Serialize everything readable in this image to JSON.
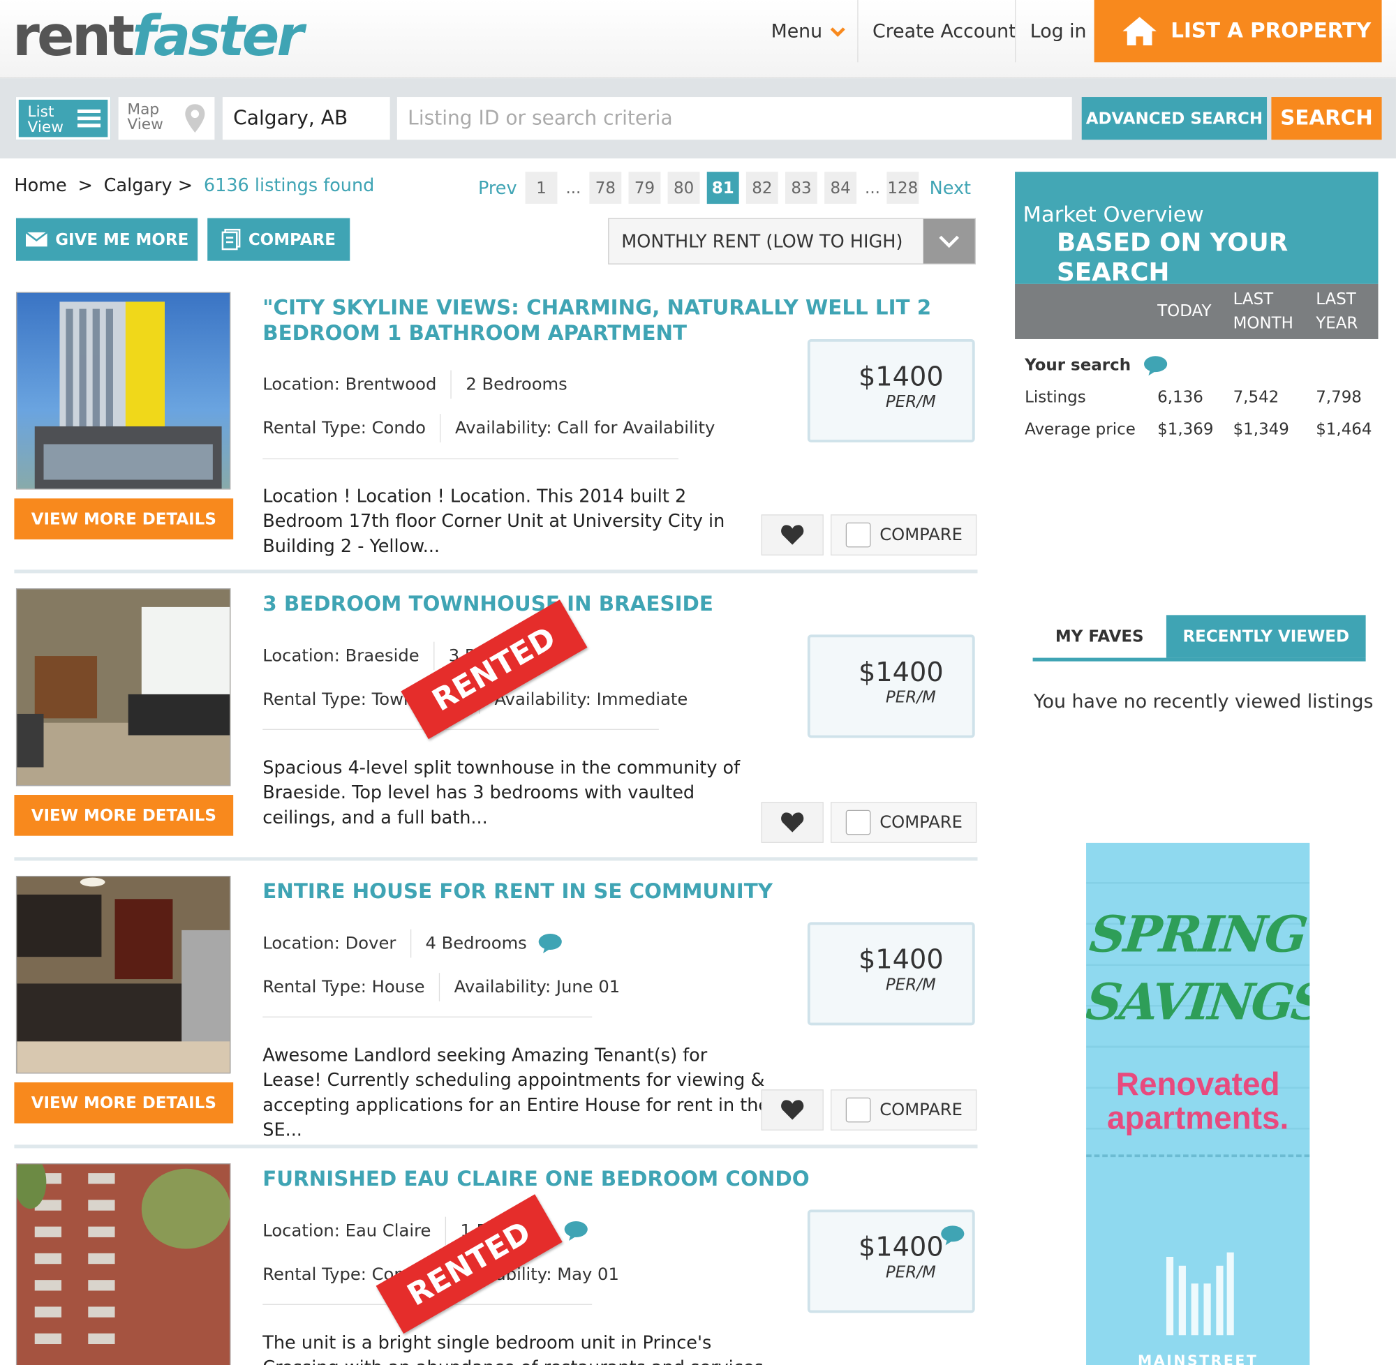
{
  "header": {
    "logo_a": "rent",
    "logo_b": "faster",
    "menu": "Menu",
    "create_account": "Create Account",
    "login": "Log in",
    "list_property": "LIST A PROPERTY"
  },
  "search": {
    "list_view_1": "List",
    "list_view_2": "View",
    "map_view_1": "Map",
    "map_view_2": "View",
    "city": "Calgary, AB",
    "placeholder": "Listing ID or search criteria",
    "advanced": "ADVANCED SEARCH",
    "search": "SEARCH"
  },
  "breadcrumb": {
    "home": "Home",
    "sep1": ">",
    "city": "Calgary",
    "sep2": ">",
    "count": "6136 listings found"
  },
  "pagination": {
    "prev": "Prev",
    "next": "Next",
    "ellipsis": "...",
    "pages": [
      "1",
      "78",
      "79",
      "80",
      "81",
      "82",
      "83",
      "84",
      "128"
    ],
    "current": "81"
  },
  "toolbar": {
    "give_more": "GIVE ME MORE",
    "compare": "COMPARE",
    "sort": "MONTHLY RENT (LOW TO HIGH)"
  },
  "listings": [
    {
      "title": "\"CITY SKYLINE VIEWS: CHARMING, NATURALLY WELL LIT 2 BEDROOM 1 BATHROOM APARTMENT",
      "location": "Location: Brentwood",
      "bedrooms": "2 Bedrooms",
      "type": "Rental Type: Condo",
      "availability": "Availability: Call for Availability",
      "price": "$1400",
      "per": "PER/M",
      "desc": "Location ! Location ! Location. This 2014 built 2 Bedroom 17th floor Corner Unit at University City in Building 2 - Yellow...",
      "rented": false,
      "details": "VIEW MORE DETAILS",
      "compare": "COMPARE"
    },
    {
      "title": "3 BEDROOM TOWNHOUSE IN BRAESIDE",
      "location": "Location: Braeside",
      "bedrooms": "3 Bedrooms",
      "type": "Rental Type: Townhouse",
      "availability": "Availability: Immediate",
      "price": "$1400",
      "per": "PER/M",
      "desc": "Spacious 4-level split townhouse in the community of Braeside. Top level has 3 bedrooms with vaulted ceilings, and a full bath...",
      "rented": true,
      "rented_label": "RENTED",
      "details": "VIEW MORE DETAILS",
      "compare": "COMPARE"
    },
    {
      "title": "ENTIRE HOUSE FOR RENT IN SE COMMUNITY",
      "location": "Location: Dover",
      "bedrooms": "4 Bedrooms",
      "type": "Rental Type: House",
      "availability": "Availability: June 01",
      "price": "$1400",
      "per": "PER/M",
      "desc": "Awesome Landlord seeking Amazing Tenant(s) for Lease! Currently scheduling appointments for viewing & accepting applications for an Entire House for rent in the SE...",
      "rented": false,
      "details": "VIEW MORE DETAILS",
      "compare": "COMPARE"
    },
    {
      "title": "FURNISHED EAU CLAIRE ONE BEDROOM CONDO",
      "location": "Location: Eau Claire",
      "bedrooms": "1 Bedroom",
      "type": "Rental Type: Condo",
      "availability": "Availability: May 01",
      "price": "$1400",
      "per": "PER/M",
      "desc": "The unit is a bright single bedroom unit in Prince's Crossing with an abundance of restaurants and services nearby...",
      "rented": true,
      "rented_label": "RENTED"
    }
  ],
  "market": {
    "title_a": "Market Overview",
    "title_b": "BASED ON YOUR SEARCH",
    "col_today": "TODAY",
    "col_last_month_1": "LAST",
    "col_last_month_2": "MONTH",
    "col_last_year_1": "LAST",
    "col_last_year_2": "YEAR",
    "your_search": "Your search",
    "listings_label": "Listings",
    "listings": [
      "6,136",
      "7,542",
      "7,798"
    ],
    "avg_label": "Average price",
    "avg": [
      "$1,369",
      "$1,349",
      "$1,464"
    ]
  },
  "faves": {
    "tab_faves": "MY FAVES",
    "tab_recent": "RECENTLY VIEWED",
    "empty": "You have no recently viewed listings"
  },
  "ad": {
    "line1": "SPRING",
    "line2": "SAVINGS",
    "line3": "Renovated",
    "line4": "apartments.",
    "brand": "MAINSTREET"
  },
  "colors": {
    "teal": "#3fa4b4",
    "orange": "#f8891d",
    "rented_red": "#e52d2b"
  }
}
